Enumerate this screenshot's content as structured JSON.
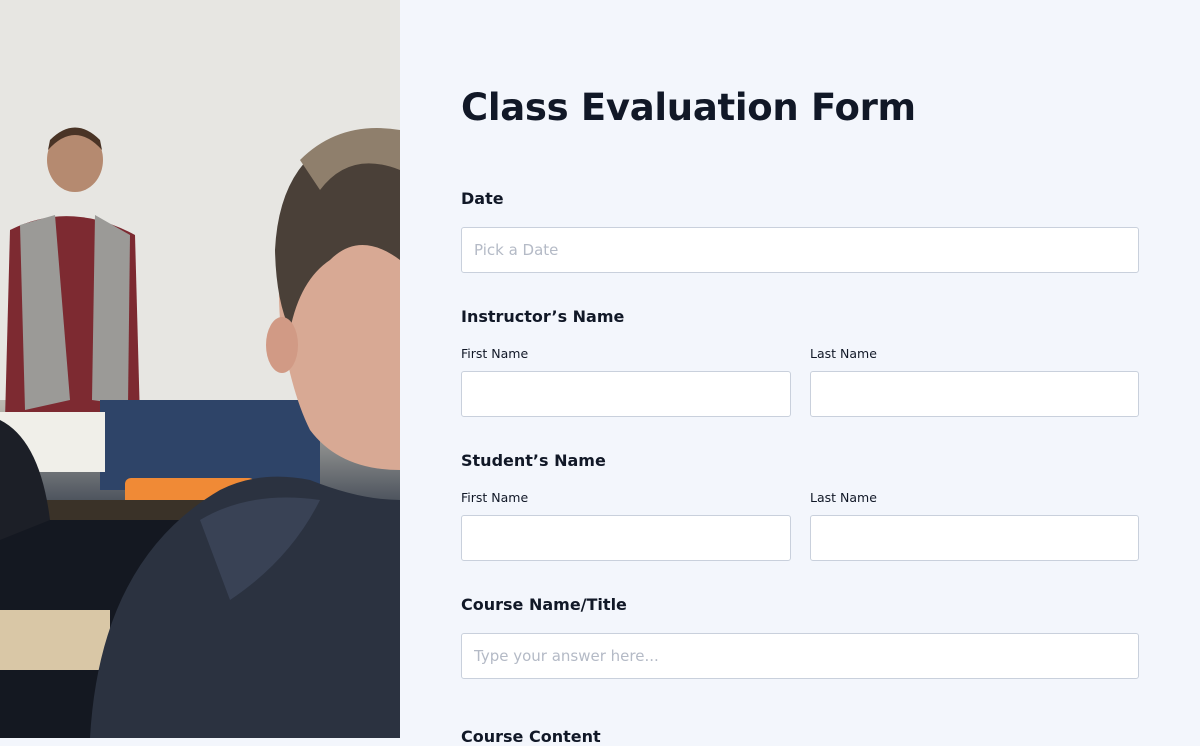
{
  "form": {
    "title": "Class Evaluation Form",
    "date": {
      "label": "Date",
      "placeholder": "Pick a Date"
    },
    "instructor": {
      "label": "Instructor’s Name",
      "first_label": "First Name",
      "last_label": "Last Name"
    },
    "student": {
      "label": "Student’s Name",
      "first_label": "First Name",
      "last_label": "Last Name"
    },
    "course": {
      "label": "Course Name/Title",
      "placeholder": "Type your answer here..."
    },
    "next_section_label": "Course Content"
  }
}
